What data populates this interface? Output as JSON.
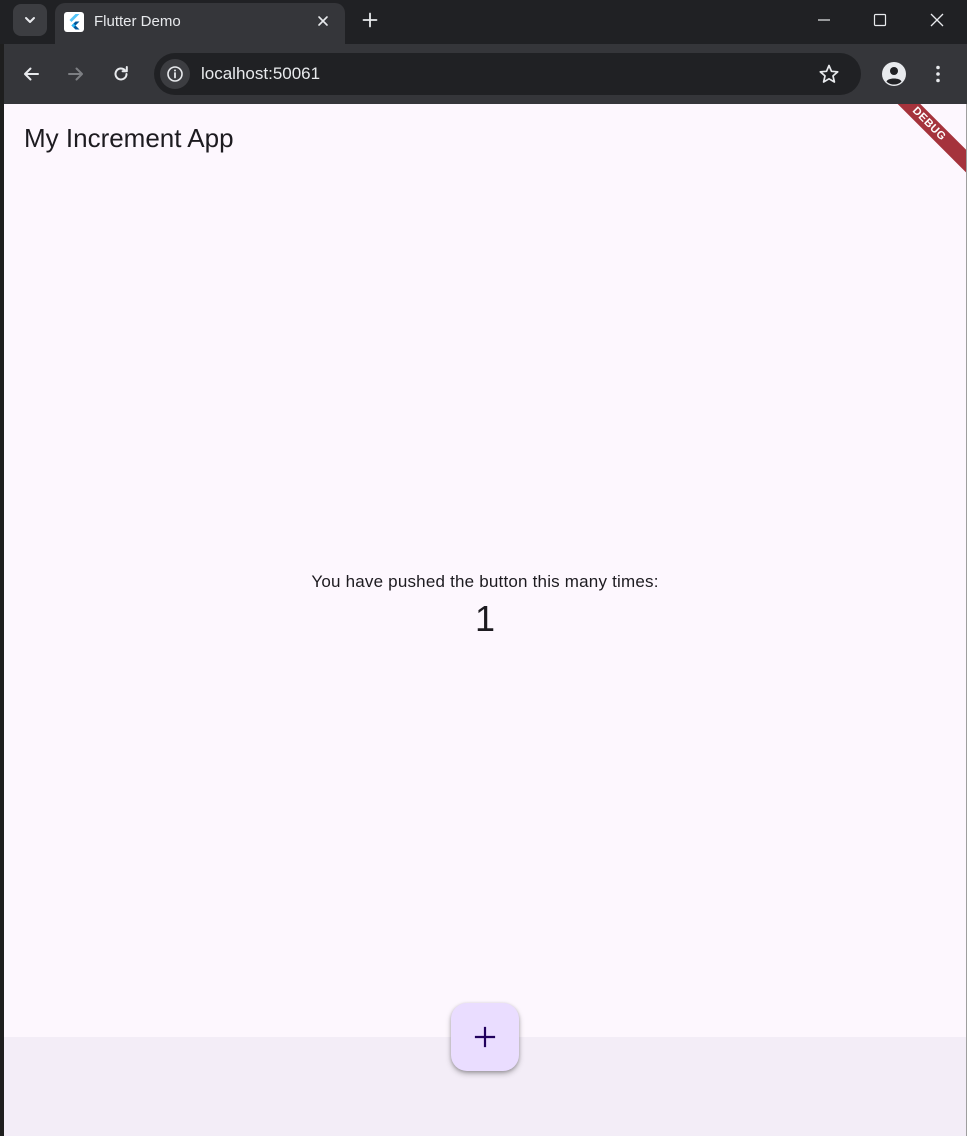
{
  "browser": {
    "tab": {
      "title": "Flutter Demo",
      "favicon": "flutter-logo-icon"
    },
    "address_bar": {
      "url": "localhost:50061"
    },
    "icons": {
      "tab_search": "chevron-down-icon",
      "tab_close": "close-icon",
      "new_tab": "plus-icon",
      "minimize": "minimize-icon",
      "maximize": "maximize-icon",
      "close_window": "close-icon",
      "back": "arrow-left-icon",
      "forward": "arrow-right-icon",
      "reload": "reload-icon",
      "site_info": "info-icon",
      "bookmark": "star-icon",
      "profile": "person-icon",
      "menu": "more-vertical-icon"
    }
  },
  "app": {
    "title": "My Increment App",
    "debug_banner": "DEBUG",
    "counter_label": "You have pushed the button this many times:",
    "counter_value": "1",
    "fab_icon": "plus-icon"
  },
  "colors": {
    "app_background": "#fdf7fe",
    "bottom_bar": "#f3edf7",
    "fab_background": "#eaddff",
    "fab_icon": "#21005d",
    "debug_banner": "#a5333c",
    "browser_frame": "#202124",
    "browser_toolbar": "#35363a"
  }
}
